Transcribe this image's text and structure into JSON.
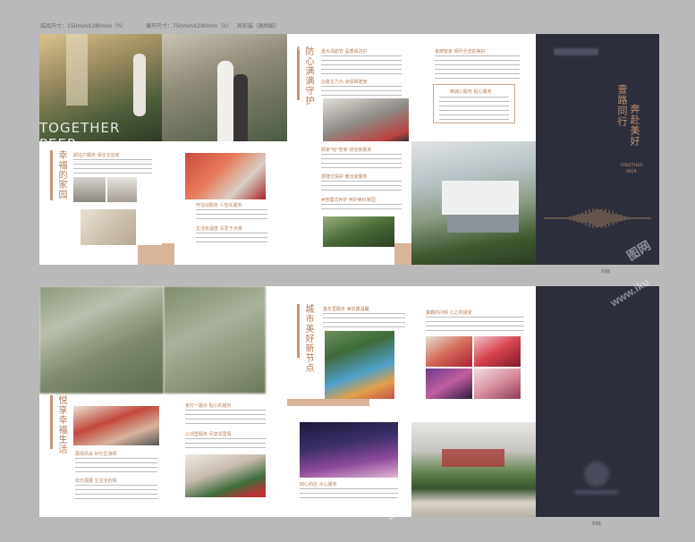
{
  "specs": {
    "folded": "成品尺寸：150mmX280mm（h）",
    "unfolded": "展开尺寸：750mmX280mm（h）",
    "paper": "异形装（高档纸）"
  },
  "top": {
    "photo_overlay": "TOGETHER PEER",
    "sec1_title": "幸福的家园",
    "sec1_items": [
      "超往户服务 保全主治家",
      "开往幼服务 人性化服务",
      "生活有温度 关爱于点滴"
    ],
    "sec2_title": "防心满满守护",
    "sec2_items": [
      "重大清航管 品质保洁护",
      "业委主力为 双保障建家",
      "顾家\"哈\"管家 双治家服务",
      "便捷式保护 暖治家服务",
      "生活区上 管设服务",
      "#管理式养护 呵护美好家园"
    ],
    "sec3_items": [
      "金牌管家 倾尽全流的美好",
      "精诚心服务 贴心服务"
    ],
    "cover_title_1": "壹路同行",
    "cover_title_2": "奔赴美好",
    "cover_sub": "TOGETHER PEER",
    "label": "封面"
  },
  "bottom": {
    "sec1_title": "悦享幸福生活",
    "sec1_items": [
      "展现风采 好社区演绎",
      "家打一展示 贴心的服务",
      "以邻里服务 尽享邻里情",
      "欢乐展展 生活全的情",
      "童话的美好"
    ],
    "sec2_title": "城市美好新节点",
    "sec2_items": [
      "童年里服务 美好童温馨",
      "四心的店 点心服务"
    ],
    "sec3_items": [
      "童趣的问候 心之所接受"
    ],
    "label": "封底"
  },
  "watermarks": [
    "iku",
    "图网",
    "www.iku"
  ]
}
